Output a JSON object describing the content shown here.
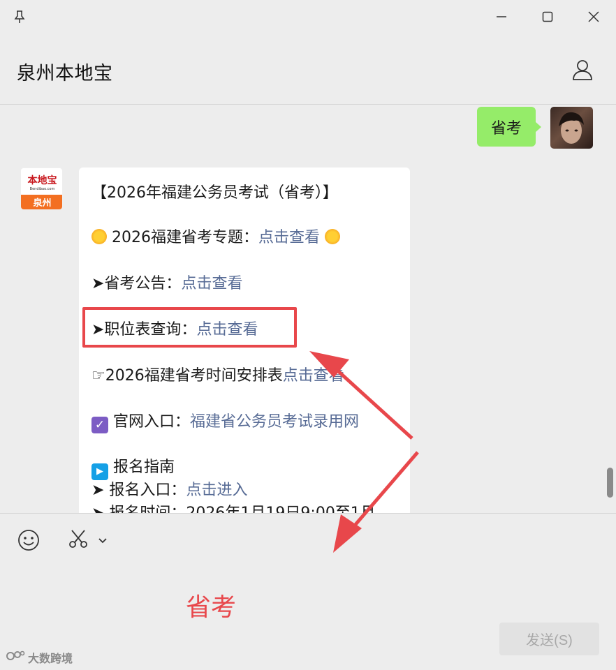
{
  "window": {
    "title": "泉州本地宝"
  },
  "messages": {
    "outgoing_text": "省考",
    "bot_logo": {
      "name": "本地宝",
      "domain": "Bendibao.com",
      "city": "泉州"
    },
    "incoming": {
      "line1": "【2026年福建公务员考试（省考）】",
      "line2_prefix": "2026福建省考专题：",
      "line2_link": "点击查看",
      "line3_prefix": "➤省考公告：",
      "line3_link": "点击查看",
      "line4_prefix": "➤职位表查询：",
      "line4_link": "点击查看",
      "line5_prefix": "☞2026福建省考时间安排表",
      "line5_link": "点击查看",
      "line6_prefix": "官网入口：",
      "line6_link": "福建省公务员考试录用网",
      "line7": "报名指南",
      "line8_prefix": "➤ 报名入口：",
      "line8_link": "点击进入",
      "line9": "➤ 报名时间：2026年1月19日9:00至1月"
    }
  },
  "composer": {
    "input_value": "省考",
    "send_label": "发送(S)"
  },
  "watermark": "大数跨境",
  "colors": {
    "outgoing_bubble": "#95ec69",
    "link": "#576b95",
    "annotation_red": "#e8474b"
  }
}
